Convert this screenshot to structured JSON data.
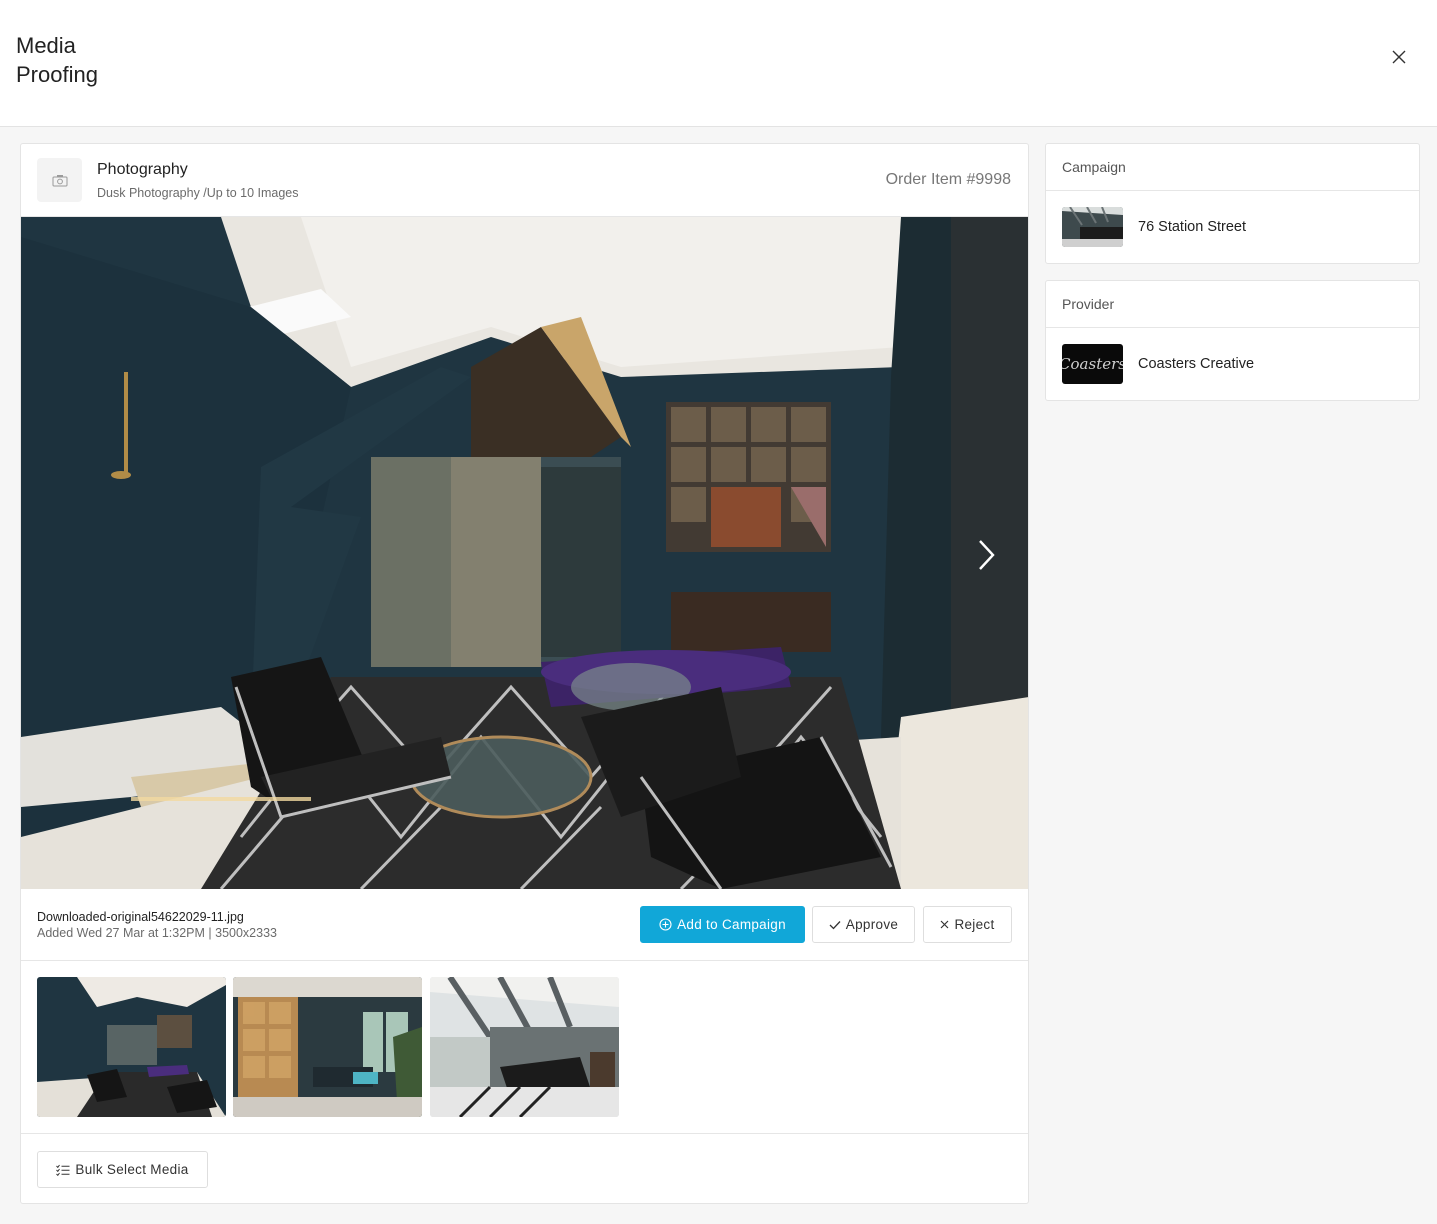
{
  "page": {
    "title": "Media Proofing"
  },
  "header": {
    "title": "Photography",
    "subtitle": "Dusk Photography /Up to 10 Images",
    "order_item": "Order Item #9998"
  },
  "media": {
    "filename": "Downloaded-original54622029-11.jpg",
    "added": "Added Wed 27 Mar at 1:32PM | 3500x2333"
  },
  "actions": {
    "add_to_campaign": "Add to Campaign",
    "approve": "Approve",
    "reject": "Reject",
    "bulk_select": "Bulk Select Media"
  },
  "campaign": {
    "heading": "Campaign",
    "name": "76 Station Street"
  },
  "provider": {
    "heading": "Provider",
    "name": "Coasters Creative",
    "logo_text": "Coasters"
  },
  "colors": {
    "primary": "#11a7d8"
  }
}
